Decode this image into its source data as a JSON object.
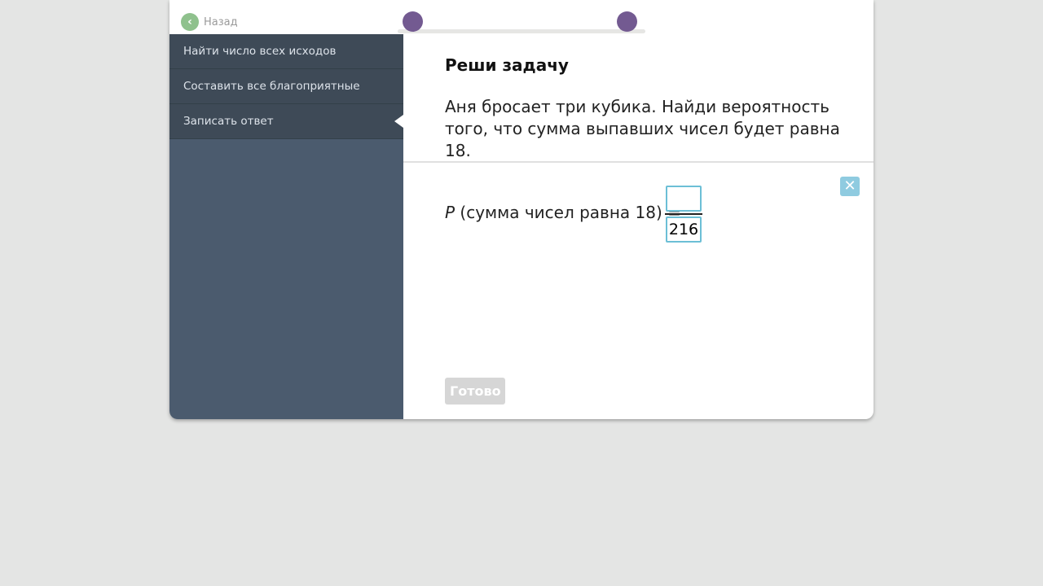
{
  "back_label": "Назад",
  "sidebar": {
    "items": [
      {
        "label": "Найти число всех исходов"
      },
      {
        "label": "Составить все благоприятные исходы"
      },
      {
        "label": "Записать ответ"
      }
    ]
  },
  "main": {
    "title": "Реши задачу",
    "task": "Аня бросает три кубика. Найди вероятность того, что сумма выпавших чисел будет равна 18.",
    "eq_var": "P",
    "eq_text": " (сумма чисел равна 18) =",
    "numerator": "",
    "denominator": "216",
    "done_label": "Готово"
  },
  "colors": {
    "accent": "#735a91",
    "input_border": "#6cbfd6"
  }
}
